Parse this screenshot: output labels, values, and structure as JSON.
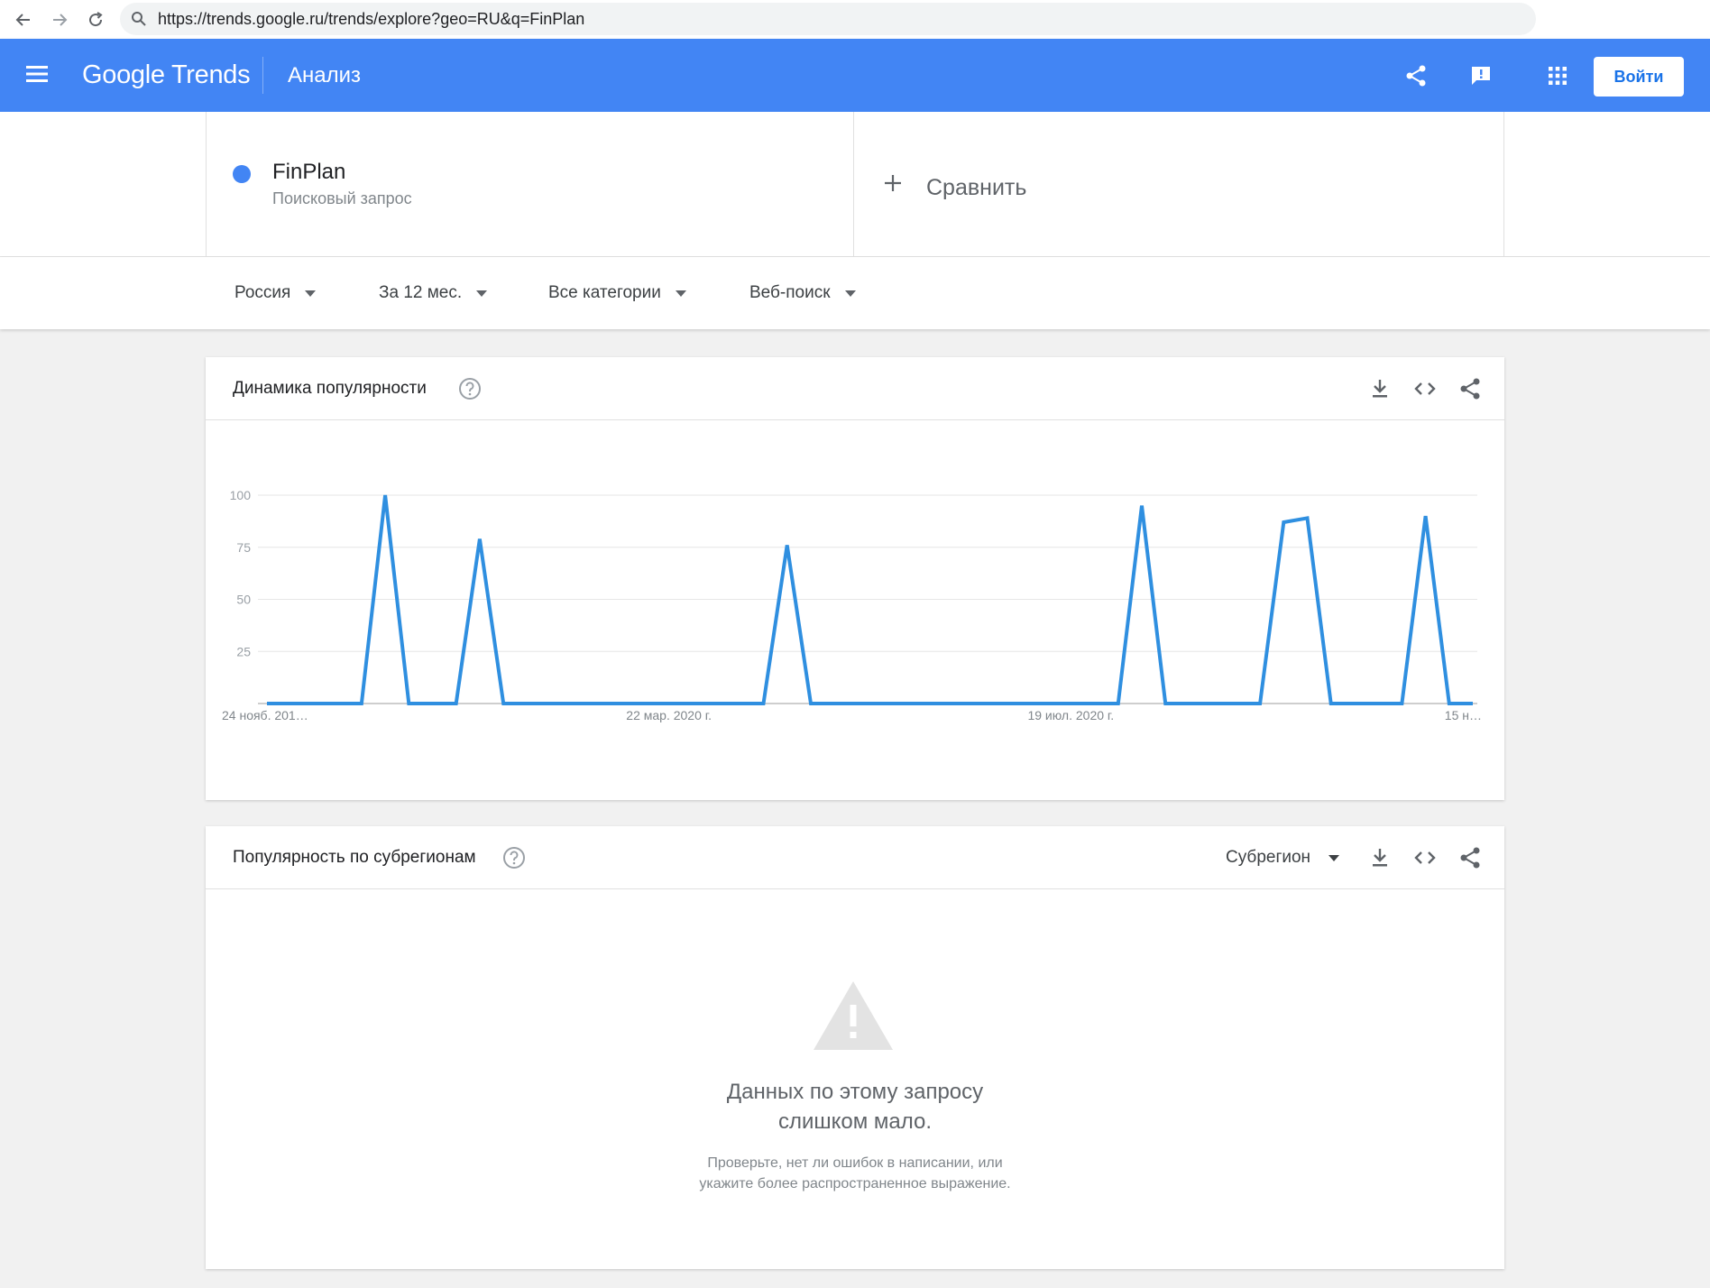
{
  "browser": {
    "url": "https://trends.google.ru/trends/explore?geo=RU&q=FinPlan"
  },
  "header": {
    "logo": "Google Trends",
    "title": "Анализ",
    "login_label": "Войти"
  },
  "term": {
    "name": "FinPlan",
    "type": "Поисковый запрос",
    "color": "#4285f4"
  },
  "compare": {
    "label": "Сравнить"
  },
  "filters": {
    "region": "Россия",
    "period": "За 12 мес.",
    "category": "Все категории",
    "search_type": "Веб-поиск"
  },
  "interest_card": {
    "title": "Динамика популярности"
  },
  "subregion_card": {
    "title": "Популярность по субрегионам",
    "selector": "Субрегион",
    "empty_title_line1": "Данных по этому запросу",
    "empty_title_line2": "слишком мало.",
    "empty_sub_line1": "Проверьте, нет ли ошибок в написании, или",
    "empty_sub_line2": "укажите более распространенное выражение."
  },
  "chart_data": {
    "type": "line",
    "ylim": [
      0,
      100
    ],
    "yticks": [
      25,
      50,
      75,
      100
    ],
    "xtick_labels": [
      {
        "index": 0,
        "label": "24 нояб. 201…"
      },
      {
        "index": 17,
        "label": "22 мар. 2020 г."
      },
      {
        "index": 34,
        "label": "19 июл. 2020 г."
      },
      {
        "index": 51,
        "label": "15 н…"
      }
    ],
    "grid": true,
    "line_color": "#2f8fe0",
    "series": [
      {
        "values": [
          0,
          0,
          0,
          0,
          0,
          100,
          0,
          0,
          0,
          79,
          0,
          0,
          0,
          0,
          0,
          0,
          0,
          0,
          0,
          0,
          0,
          0,
          76,
          0,
          0,
          0,
          0,
          0,
          0,
          0,
          0,
          0,
          0,
          0,
          0,
          0,
          0,
          95,
          0,
          0,
          0,
          0,
          0,
          87,
          89,
          0,
          0,
          0,
          0,
          90,
          0,
          0
        ]
      }
    ]
  }
}
